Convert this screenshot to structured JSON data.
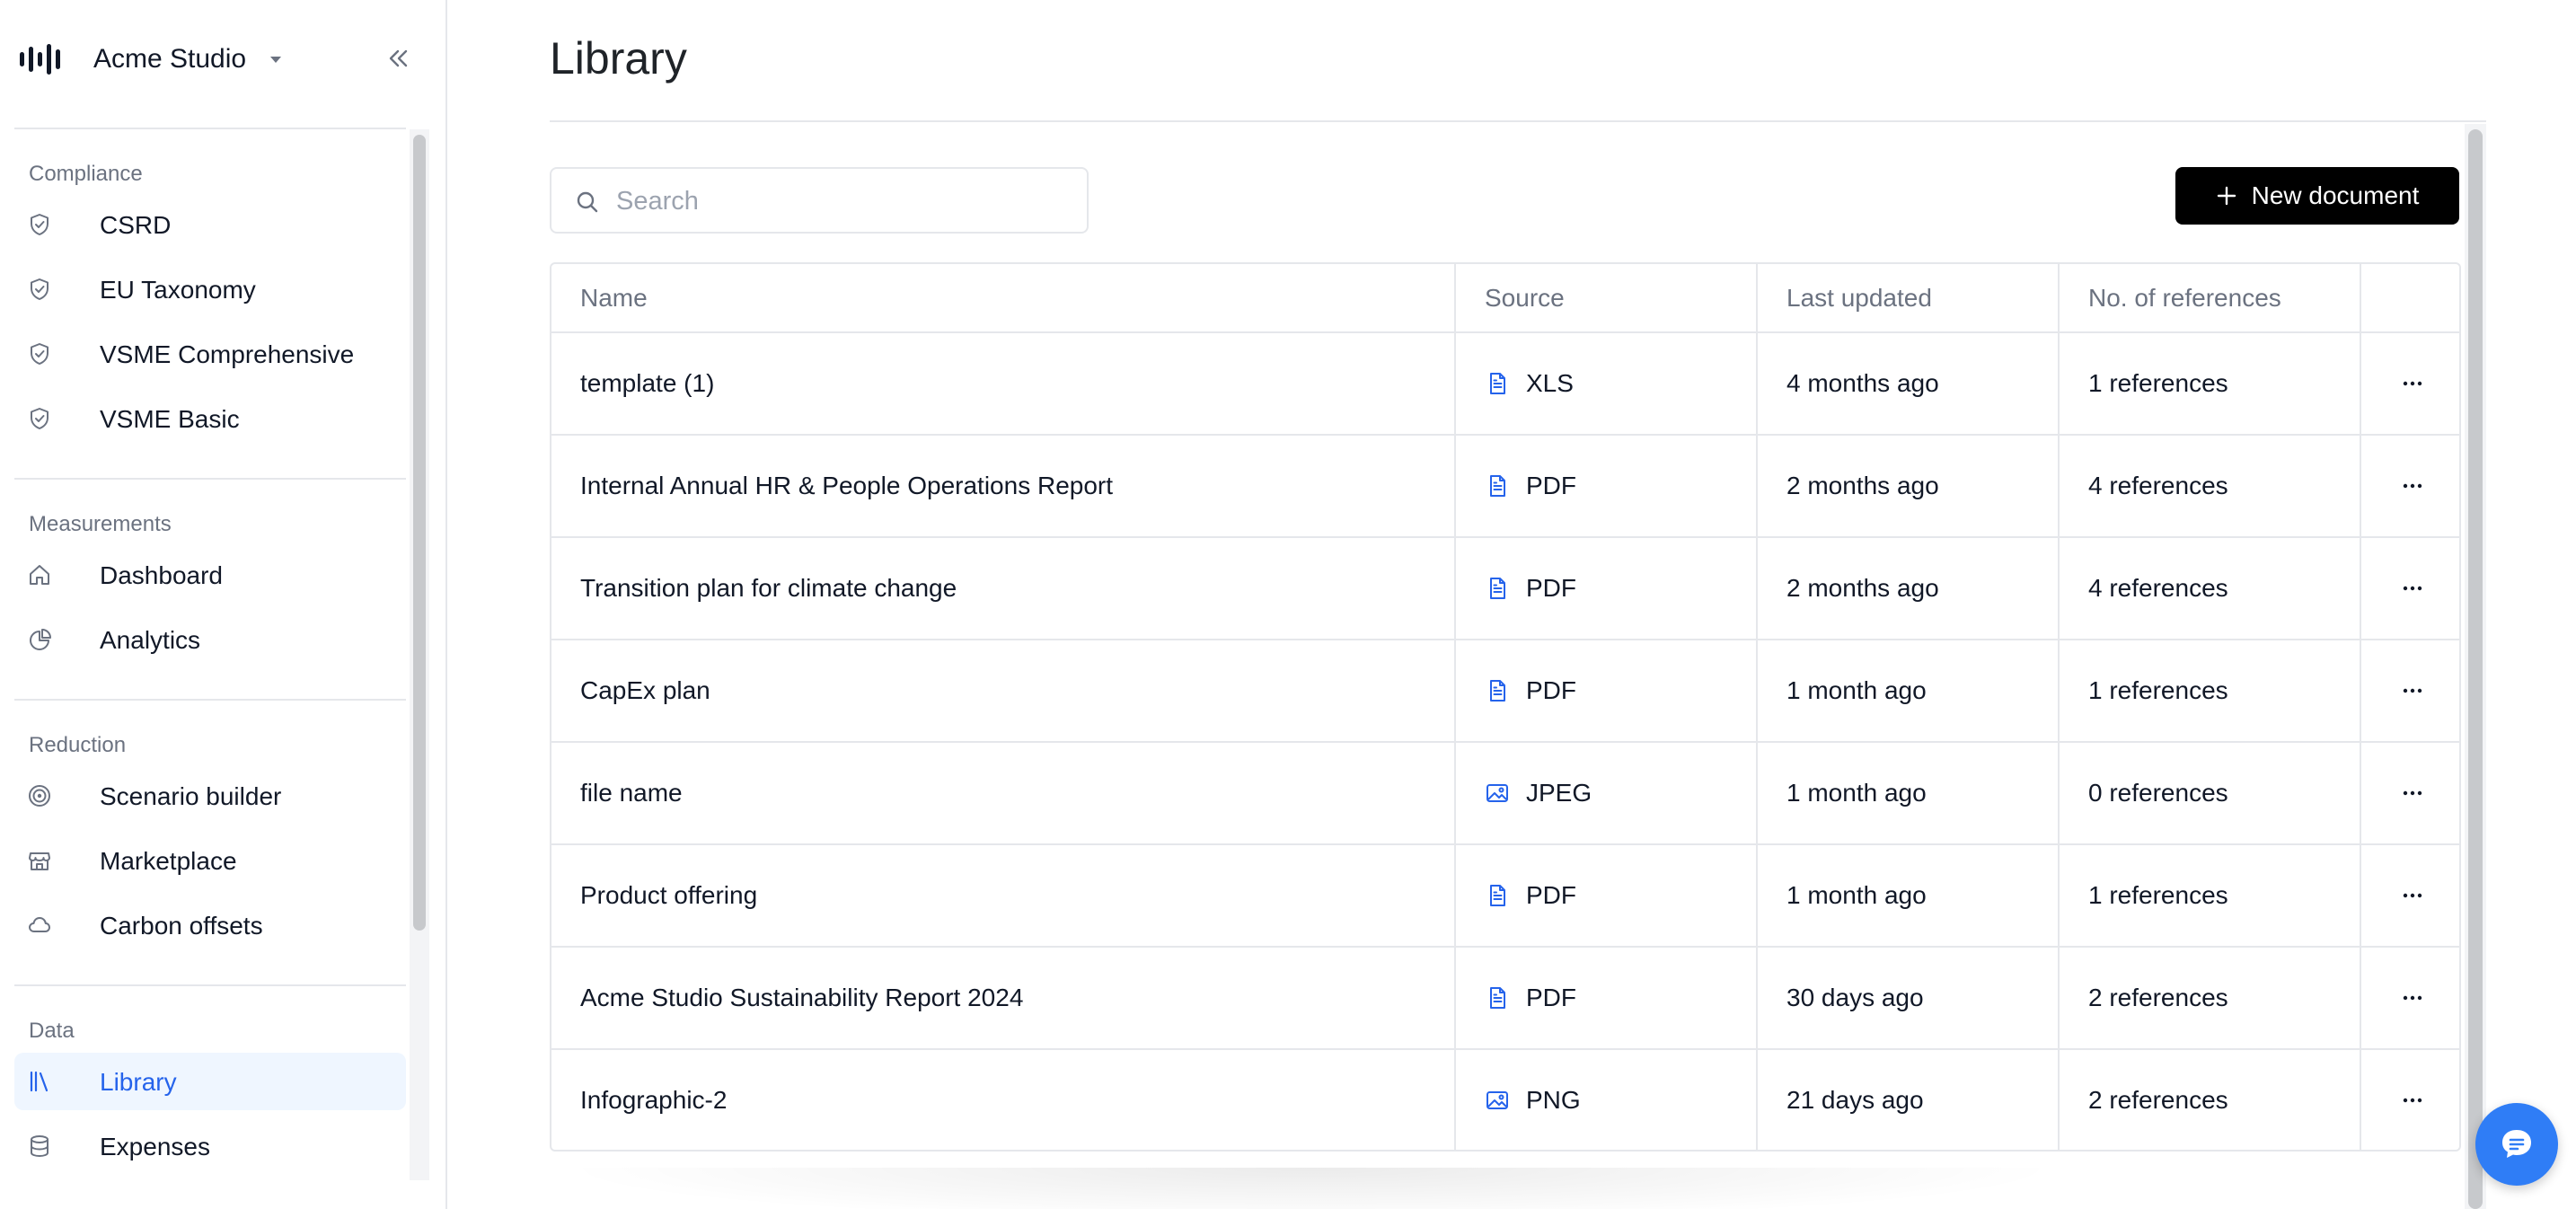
{
  "app": {
    "workspace_name": "Acme Studio"
  },
  "sidebar": {
    "sections": [
      {
        "title": "Compliance",
        "items": [
          {
            "label": "CSRD",
            "icon": "shield-check-icon"
          },
          {
            "label": "EU Taxonomy",
            "icon": "shield-check-icon"
          },
          {
            "label": "VSME Comprehensive",
            "icon": "shield-check-icon"
          },
          {
            "label": "VSME Basic",
            "icon": "shield-check-icon"
          }
        ]
      },
      {
        "title": "Measurements",
        "items": [
          {
            "label": "Dashboard",
            "icon": "home-icon"
          },
          {
            "label": "Analytics",
            "icon": "pie-chart-icon"
          }
        ]
      },
      {
        "title": "Reduction",
        "items": [
          {
            "label": "Scenario builder",
            "icon": "target-icon"
          },
          {
            "label": "Marketplace",
            "icon": "store-icon"
          },
          {
            "label": "Carbon offsets",
            "icon": "cloud-icon"
          }
        ]
      },
      {
        "title": "Data",
        "items": [
          {
            "label": "Library",
            "icon": "library-icon",
            "active": true
          },
          {
            "label": "Expenses",
            "icon": "database-icon"
          }
        ]
      }
    ]
  },
  "main": {
    "title": "Library",
    "search": {
      "placeholder": "Search",
      "value": ""
    },
    "new_document_label": "New document",
    "table": {
      "columns": [
        "Name",
        "Source",
        "Last updated",
        "No. of references",
        ""
      ],
      "rows": [
        {
          "name": "template (1)",
          "source": "XLS",
          "source_icon": "file-text-icon",
          "updated": "4 months ago",
          "references": "1 references"
        },
        {
          "name": "Internal Annual HR & People Operations Report",
          "source": "PDF",
          "source_icon": "file-text-icon",
          "updated": "2 months ago",
          "references": "4 references"
        },
        {
          "name": "Transition plan for climate change",
          "source": "PDF",
          "source_icon": "file-text-icon",
          "updated": "2 months ago",
          "references": "4 references"
        },
        {
          "name": "CapEx plan",
          "source": "PDF",
          "source_icon": "file-text-icon",
          "updated": "1 month ago",
          "references": "1 references"
        },
        {
          "name": "file name",
          "source": "JPEG",
          "source_icon": "image-icon",
          "updated": "1 month ago",
          "references": "0 references"
        },
        {
          "name": "Product offering",
          "source": "PDF",
          "source_icon": "file-text-icon",
          "updated": "1 month ago",
          "references": "1 references"
        },
        {
          "name": "Acme Studio Sustainability Report 2024",
          "source": "PDF",
          "source_icon": "file-text-icon",
          "updated": "30 days ago",
          "references": "2 references"
        },
        {
          "name": "Infographic-2",
          "source": "PNG",
          "source_icon": "image-icon",
          "updated": "21 days ago",
          "references": "2 references"
        }
      ]
    }
  },
  "colors": {
    "accent": "#2563eb",
    "active_bg": "#eff6ff",
    "button_bg": "#000000",
    "chat_fab": "#2f7df6",
    "border": "#e5e7eb",
    "muted_text": "#6b7280"
  }
}
